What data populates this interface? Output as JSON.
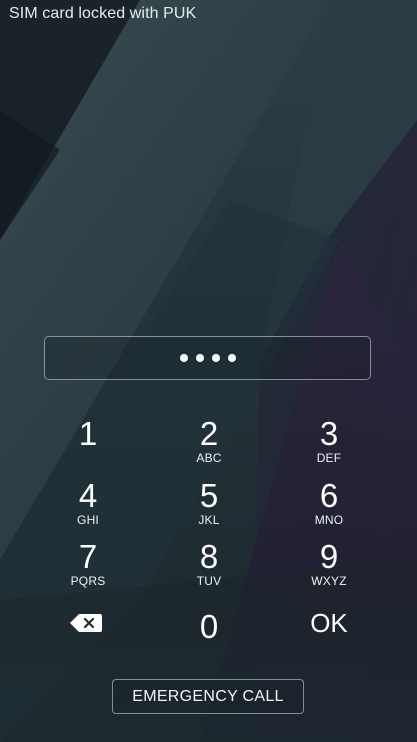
{
  "status": {
    "message": "SIM card locked with PUK"
  },
  "pin_entry": {
    "digits_entered": 4
  },
  "keypad": {
    "keys": [
      {
        "number": "1",
        "letters": ""
      },
      {
        "number": "2",
        "letters": "ABC"
      },
      {
        "number": "3",
        "letters": "DEF"
      },
      {
        "number": "4",
        "letters": "GHI"
      },
      {
        "number": "5",
        "letters": "JKL"
      },
      {
        "number": "6",
        "letters": "MNO"
      },
      {
        "number": "7",
        "letters": "PQRS"
      },
      {
        "number": "8",
        "letters": "TUV"
      },
      {
        "number": "9",
        "letters": "WXYZ"
      }
    ],
    "zero": "0",
    "ok": "OK",
    "backspace_icon": "backspace-icon"
  },
  "emergency": {
    "label": "EMERGENCY CALL"
  },
  "colors": {
    "text": "#ffffff",
    "background": "#1d2a30",
    "accent_purple": "#2a1f3a"
  }
}
